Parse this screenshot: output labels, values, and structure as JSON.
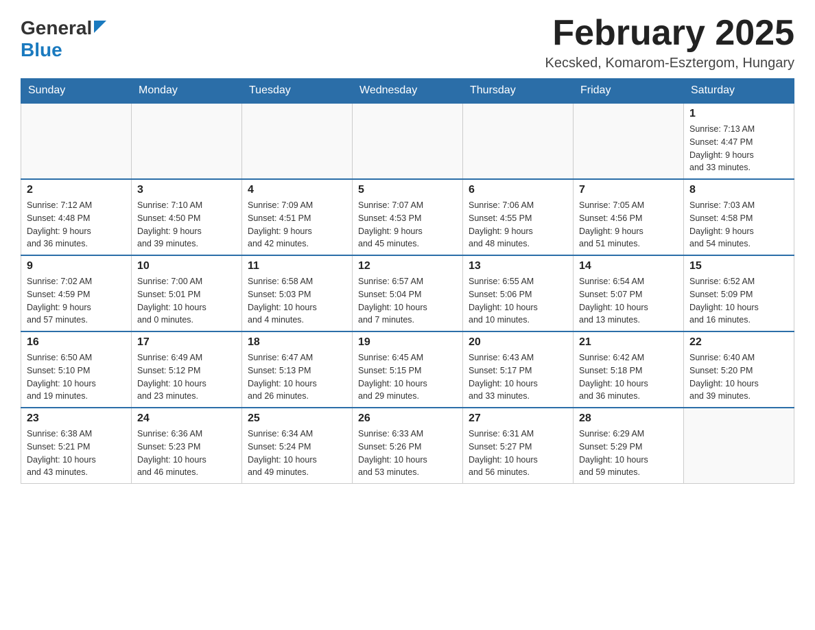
{
  "header": {
    "logo_general": "General",
    "logo_blue": "Blue",
    "month_title": "February 2025",
    "location": "Kecsked, Komarom-Esztergom, Hungary"
  },
  "weekdays": [
    "Sunday",
    "Monday",
    "Tuesday",
    "Wednesday",
    "Thursday",
    "Friday",
    "Saturday"
  ],
  "weeks": [
    [
      {
        "day": "",
        "info": ""
      },
      {
        "day": "",
        "info": ""
      },
      {
        "day": "",
        "info": ""
      },
      {
        "day": "",
        "info": ""
      },
      {
        "day": "",
        "info": ""
      },
      {
        "day": "",
        "info": ""
      },
      {
        "day": "1",
        "info": "Sunrise: 7:13 AM\nSunset: 4:47 PM\nDaylight: 9 hours\nand 33 minutes."
      }
    ],
    [
      {
        "day": "2",
        "info": "Sunrise: 7:12 AM\nSunset: 4:48 PM\nDaylight: 9 hours\nand 36 minutes."
      },
      {
        "day": "3",
        "info": "Sunrise: 7:10 AM\nSunset: 4:50 PM\nDaylight: 9 hours\nand 39 minutes."
      },
      {
        "day": "4",
        "info": "Sunrise: 7:09 AM\nSunset: 4:51 PM\nDaylight: 9 hours\nand 42 minutes."
      },
      {
        "day": "5",
        "info": "Sunrise: 7:07 AM\nSunset: 4:53 PM\nDaylight: 9 hours\nand 45 minutes."
      },
      {
        "day": "6",
        "info": "Sunrise: 7:06 AM\nSunset: 4:55 PM\nDaylight: 9 hours\nand 48 minutes."
      },
      {
        "day": "7",
        "info": "Sunrise: 7:05 AM\nSunset: 4:56 PM\nDaylight: 9 hours\nand 51 minutes."
      },
      {
        "day": "8",
        "info": "Sunrise: 7:03 AM\nSunset: 4:58 PM\nDaylight: 9 hours\nand 54 minutes."
      }
    ],
    [
      {
        "day": "9",
        "info": "Sunrise: 7:02 AM\nSunset: 4:59 PM\nDaylight: 9 hours\nand 57 minutes."
      },
      {
        "day": "10",
        "info": "Sunrise: 7:00 AM\nSunset: 5:01 PM\nDaylight: 10 hours\nand 0 minutes."
      },
      {
        "day": "11",
        "info": "Sunrise: 6:58 AM\nSunset: 5:03 PM\nDaylight: 10 hours\nand 4 minutes."
      },
      {
        "day": "12",
        "info": "Sunrise: 6:57 AM\nSunset: 5:04 PM\nDaylight: 10 hours\nand 7 minutes."
      },
      {
        "day": "13",
        "info": "Sunrise: 6:55 AM\nSunset: 5:06 PM\nDaylight: 10 hours\nand 10 minutes."
      },
      {
        "day": "14",
        "info": "Sunrise: 6:54 AM\nSunset: 5:07 PM\nDaylight: 10 hours\nand 13 minutes."
      },
      {
        "day": "15",
        "info": "Sunrise: 6:52 AM\nSunset: 5:09 PM\nDaylight: 10 hours\nand 16 minutes."
      }
    ],
    [
      {
        "day": "16",
        "info": "Sunrise: 6:50 AM\nSunset: 5:10 PM\nDaylight: 10 hours\nand 19 minutes."
      },
      {
        "day": "17",
        "info": "Sunrise: 6:49 AM\nSunset: 5:12 PM\nDaylight: 10 hours\nand 23 minutes."
      },
      {
        "day": "18",
        "info": "Sunrise: 6:47 AM\nSunset: 5:13 PM\nDaylight: 10 hours\nand 26 minutes."
      },
      {
        "day": "19",
        "info": "Sunrise: 6:45 AM\nSunset: 5:15 PM\nDaylight: 10 hours\nand 29 minutes."
      },
      {
        "day": "20",
        "info": "Sunrise: 6:43 AM\nSunset: 5:17 PM\nDaylight: 10 hours\nand 33 minutes."
      },
      {
        "day": "21",
        "info": "Sunrise: 6:42 AM\nSunset: 5:18 PM\nDaylight: 10 hours\nand 36 minutes."
      },
      {
        "day": "22",
        "info": "Sunrise: 6:40 AM\nSunset: 5:20 PM\nDaylight: 10 hours\nand 39 minutes."
      }
    ],
    [
      {
        "day": "23",
        "info": "Sunrise: 6:38 AM\nSunset: 5:21 PM\nDaylight: 10 hours\nand 43 minutes."
      },
      {
        "day": "24",
        "info": "Sunrise: 6:36 AM\nSunset: 5:23 PM\nDaylight: 10 hours\nand 46 minutes."
      },
      {
        "day": "25",
        "info": "Sunrise: 6:34 AM\nSunset: 5:24 PM\nDaylight: 10 hours\nand 49 minutes."
      },
      {
        "day": "26",
        "info": "Sunrise: 6:33 AM\nSunset: 5:26 PM\nDaylight: 10 hours\nand 53 minutes."
      },
      {
        "day": "27",
        "info": "Sunrise: 6:31 AM\nSunset: 5:27 PM\nDaylight: 10 hours\nand 56 minutes."
      },
      {
        "day": "28",
        "info": "Sunrise: 6:29 AM\nSunset: 5:29 PM\nDaylight: 10 hours\nand 59 minutes."
      },
      {
        "day": "",
        "info": ""
      }
    ]
  ]
}
